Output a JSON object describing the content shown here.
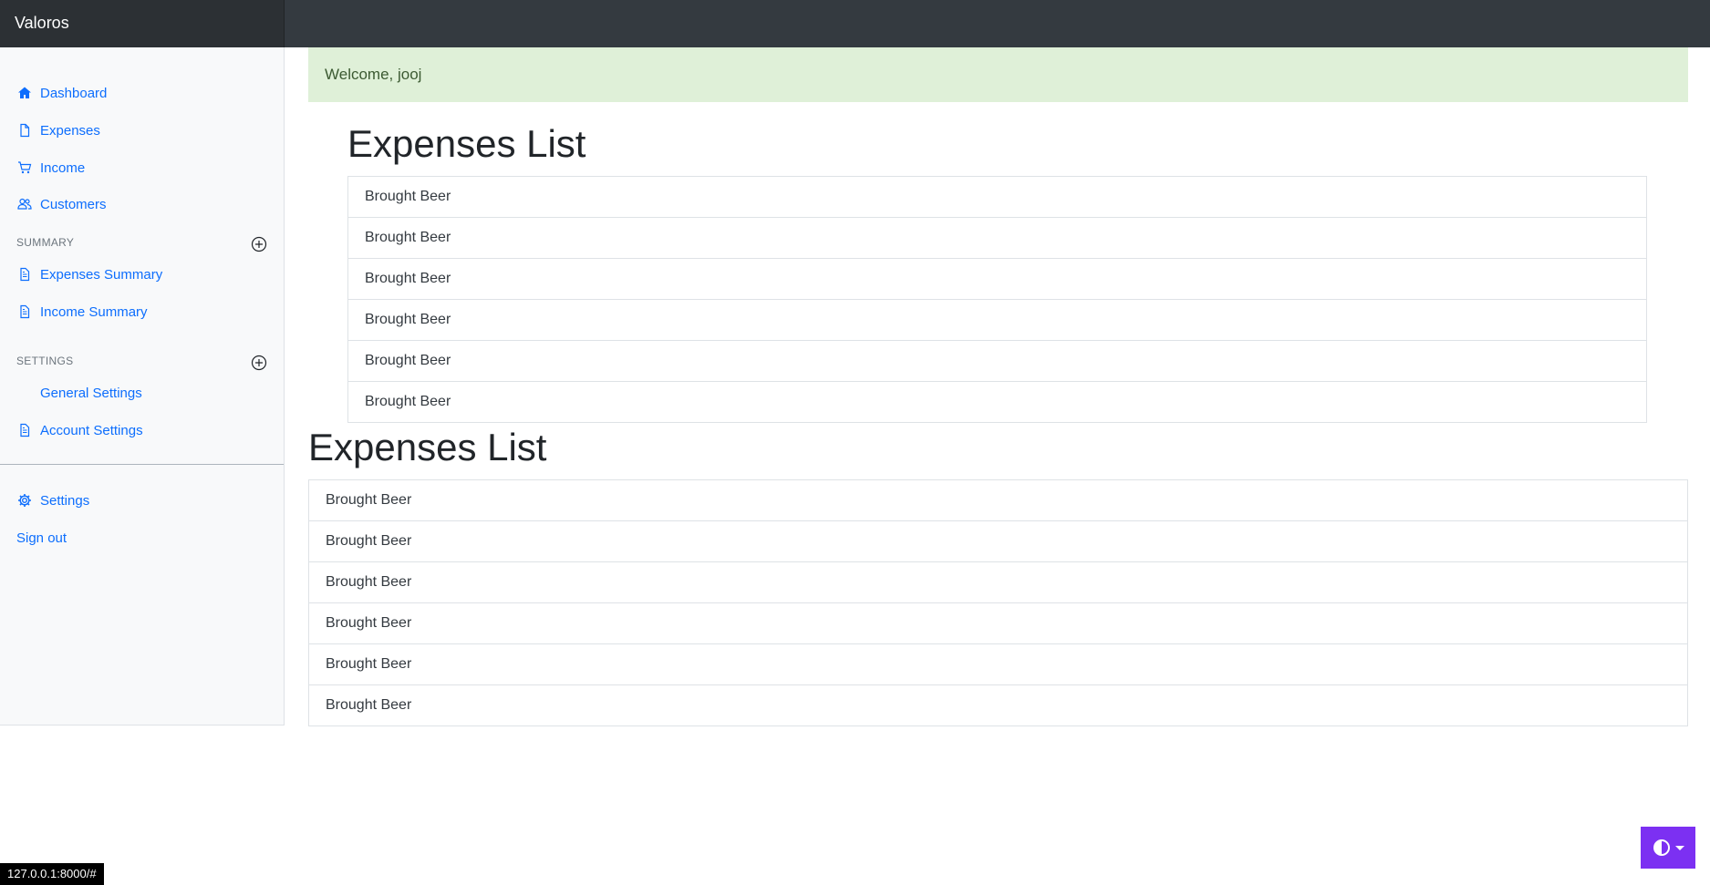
{
  "app": {
    "brand": "Valoros"
  },
  "sidebar": {
    "main_items": [
      {
        "label": "Dashboard",
        "icon": "home-icon"
      },
      {
        "label": "Expenses",
        "icon": "file-icon"
      },
      {
        "label": "Income",
        "icon": "cart-icon"
      },
      {
        "label": "Customers",
        "icon": "users-icon"
      }
    ],
    "summary": {
      "heading": "SUMMARY",
      "items": [
        {
          "label": "Expenses Summary",
          "icon": "file-text-icon"
        },
        {
          "label": "Income Summary",
          "icon": "file-text-icon"
        }
      ]
    },
    "settings": {
      "heading": "SETTINGS",
      "items": [
        {
          "label": "General Settings"
        },
        {
          "label": "Account Settings",
          "icon": "file-text-icon"
        }
      ]
    },
    "footer_items": [
      {
        "label": "Settings",
        "icon": "gear-icon"
      },
      {
        "label": "Sign out"
      }
    ]
  },
  "main": {
    "alert": "Welcome, jooj",
    "lists": [
      {
        "title": "Expenses List",
        "items": [
          "Brought Beer",
          "Brought Beer",
          "Brought Beer",
          "Brought Beer",
          "Brought Beer",
          "Brought Beer"
        ]
      },
      {
        "title": "Expenses List",
        "items": [
          "Brought Beer",
          "Brought Beer",
          "Brought Beer",
          "Brought Beer",
          "Brought Beer",
          "Brought Beer"
        ]
      }
    ]
  },
  "status_url": "127.0.0.1:8000/#",
  "colors": {
    "link": "#0d6efd",
    "topbar": "#343a40",
    "alert_bg": "#dff0d8",
    "theme_button": "#7c30f2"
  }
}
